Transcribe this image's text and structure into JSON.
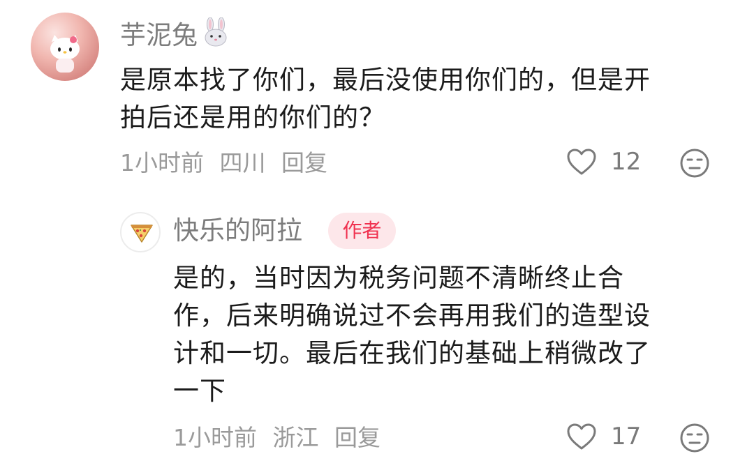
{
  "comment": {
    "username": "芋泥兔",
    "body_lines": [
      "是原本找了你们，最后没使用你们的，但是开",
      "拍后还是用的你们的？"
    ],
    "time": "1小时前",
    "location": "四川",
    "reply_label": "回复",
    "likes": "12",
    "icons": [
      "rabbit-emoji",
      "heart-icon",
      "dislike-face-icon"
    ]
  },
  "reply": {
    "username": "快乐的阿拉",
    "author_badge": "作者",
    "body_lines": [
      "是的，当时因为税务问题不清晰终止合",
      "作，后来明确说过不会再用我们的造型设",
      "计和一切。最后在我们的基础上稍微改了",
      "一下"
    ],
    "time": "1小时前",
    "location": "浙江",
    "reply_label": "回复",
    "likes": "17",
    "icons": [
      "pizza-icon",
      "heart-icon",
      "dislike-face-icon"
    ]
  },
  "colors": {
    "text": "#1b1b1b",
    "meta": "#9a9a9a",
    "username": "#7c7c7c",
    "badge_bg": "#fde7ea",
    "badge_text": "#f0314f"
  }
}
